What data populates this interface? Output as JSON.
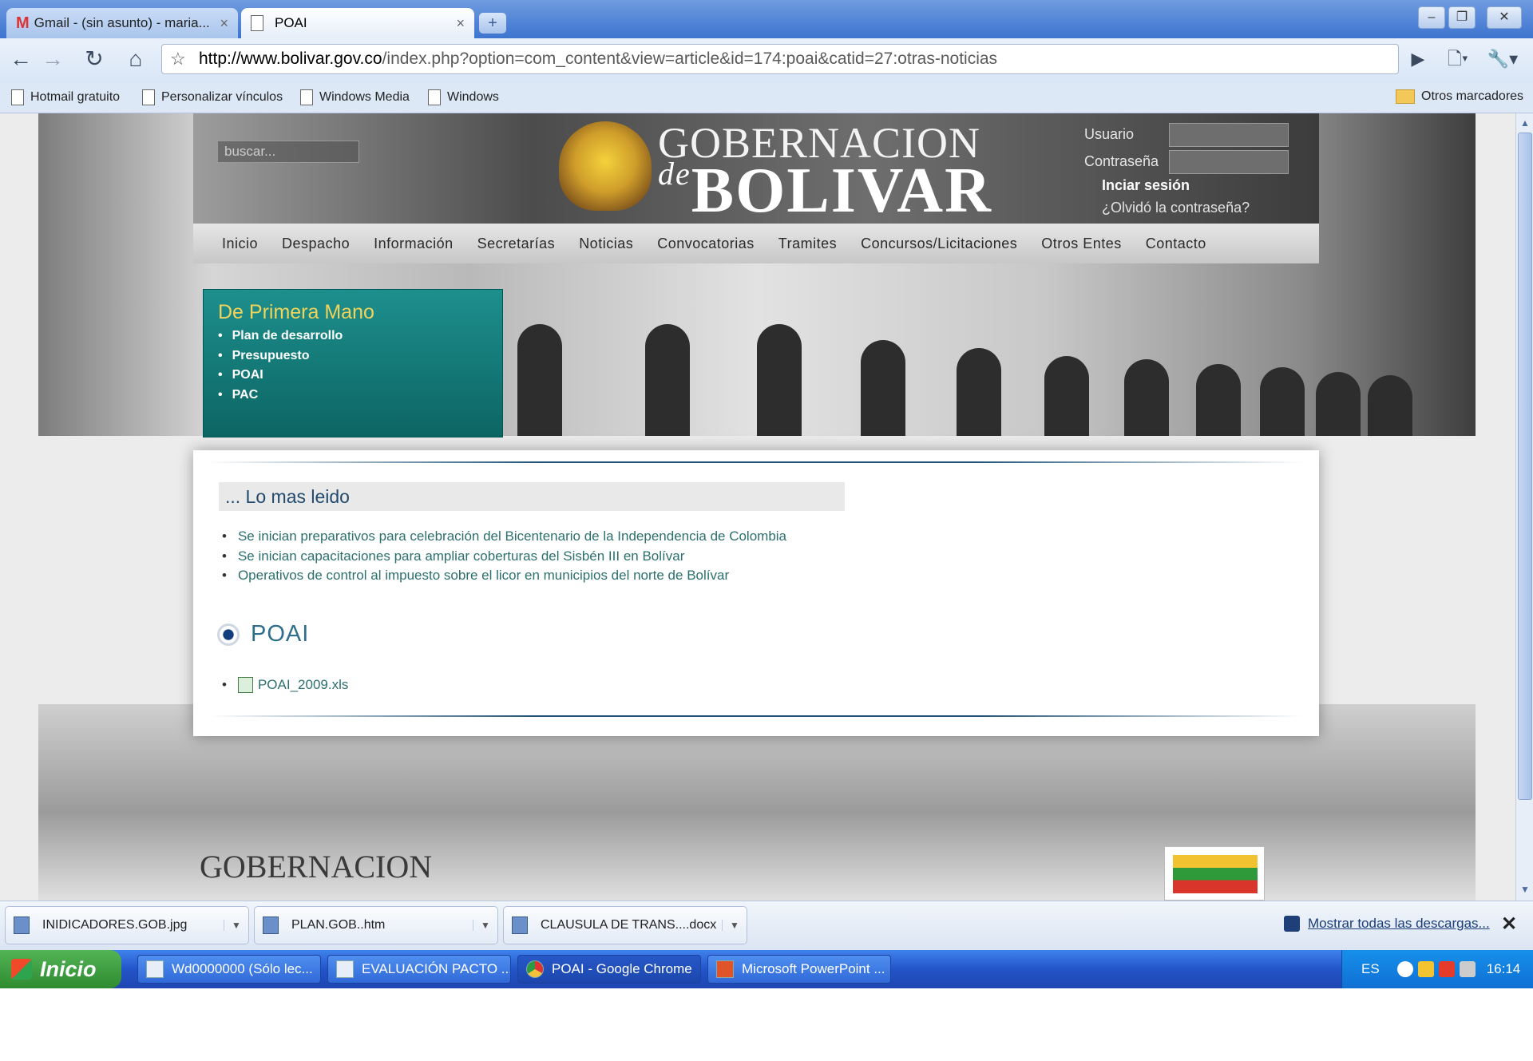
{
  "browser": {
    "tabs": [
      {
        "title": "Gmail - (sin asunto) - maria...",
        "icon": "gmail-icon"
      },
      {
        "title": "POAI",
        "icon": "page-icon"
      }
    ],
    "url_host": "http://www.bolivar.gov.co",
    "url_rest": "/index.php?option=com_content&view=article&id=174:poai&catid=27:otras-noticias",
    "bookmarks": [
      "Hotmail gratuito",
      "Personalizar vínculos",
      "Windows Media",
      "Windows"
    ],
    "other_bookmarks": "Otros marcadores"
  },
  "site": {
    "search_placeholder": "buscar...",
    "logo_line1": "GOBERNACION",
    "logo_de": "de",
    "logo_line2": "BOLIVAR",
    "login": {
      "user_label": "Usuario",
      "password_label": "Contraseña",
      "login_link": "Inciar sesión",
      "forgot_link": "¿Olvidó la contraseña?"
    },
    "menu": [
      "Inicio",
      "Despacho",
      "Información",
      "Secretarías",
      "Noticias",
      "Convocatorias",
      "Tramites",
      "Concursos/Licitaciones",
      "Otros Entes",
      "Contacto"
    ],
    "primera_mano": {
      "title": "De Primera Mano",
      "items": [
        "Plan de desarrollo",
        "Presupuesto",
        "POAI",
        "PAC"
      ]
    },
    "lo_mas_leido": {
      "title": "... Lo mas leido",
      "items": [
        "Se inician preparativos para celebración del Bicentenario de la Independencia de Colombia",
        "Se inician capacitaciones para ampliar coberturas del Sisbén III en Bolívar",
        "Operativos de control al impuesto sobre el licor en municipios del norte de Bolívar"
      ]
    },
    "article_title": "POAI",
    "attachment": "POAI_2009.xls",
    "footer_logo": "GOBERNACION"
  },
  "downloads": {
    "items": [
      "INIDICADORES.GOB.jpg",
      "PLAN.GOB..htm",
      "CLAUSULA DE TRANS....docx"
    ],
    "show_all": "Mostrar todas las descargas..."
  },
  "taskbar": {
    "start": "Inicio",
    "tasks": [
      "Wd0000000 (Sólo lec...",
      "EVALUACIÓN PACTO ...",
      "POAI - Google Chrome",
      "Microsoft PowerPoint ..."
    ],
    "lang": "ES",
    "clock": "16:14"
  },
  "colors": {
    "accent_teal": "#1d8f8d",
    "link": "#2c6f6f",
    "taskbar_blue": "#2354c8"
  }
}
